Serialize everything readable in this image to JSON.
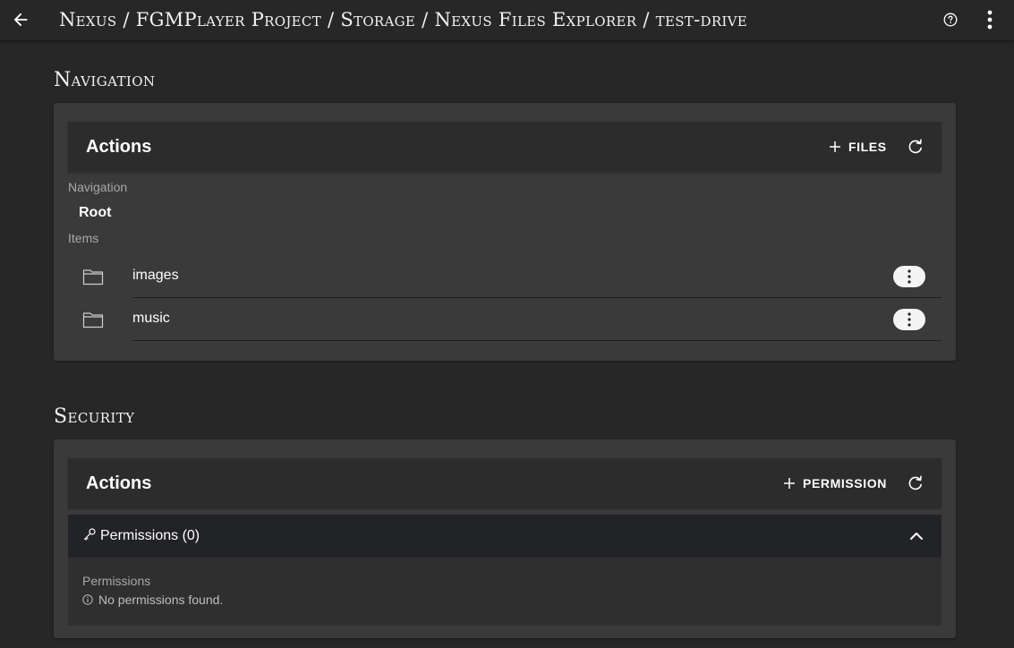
{
  "header": {
    "breadcrumb": "Nexus / FGMPlayer Project / Storage / Nexus Files Explorer / test-drive",
    "back_icon": "arrow-left-icon",
    "help_icon": "help-circle-icon",
    "more_icon": "dots-vertical-icon"
  },
  "navigation_section": {
    "heading": "Navigation",
    "actions": {
      "title": "Actions",
      "add_label": "FILES",
      "add_icon": "plus-icon",
      "refresh_icon": "refresh-icon"
    },
    "navigation_label": "Navigation",
    "root_label": "Root",
    "items_label": "Items",
    "items": [
      {
        "name": "images",
        "icon": "folder-icon",
        "menu_icon": "dots-vertical-icon"
      },
      {
        "name": "music",
        "icon": "folder-icon",
        "menu_icon": "dots-vertical-icon"
      }
    ]
  },
  "security_section": {
    "heading": "Security",
    "actions": {
      "title": "Actions",
      "add_label": "PERMISSION",
      "add_icon": "plus-icon",
      "refresh_icon": "refresh-icon"
    },
    "permissions": {
      "title": "Permissions (0)",
      "key_icon": "key-icon",
      "expanded_icon": "chevron-up-icon",
      "body_label": "Permissions",
      "empty_message": "No permissions found.",
      "info_icon": "info-icon"
    }
  },
  "colors": {
    "background": "#272727",
    "panel": "#3a3a3a",
    "actions_bar": "#2c2c2c",
    "text": "#ffffff",
    "muted_text": "#a8a8a8"
  }
}
